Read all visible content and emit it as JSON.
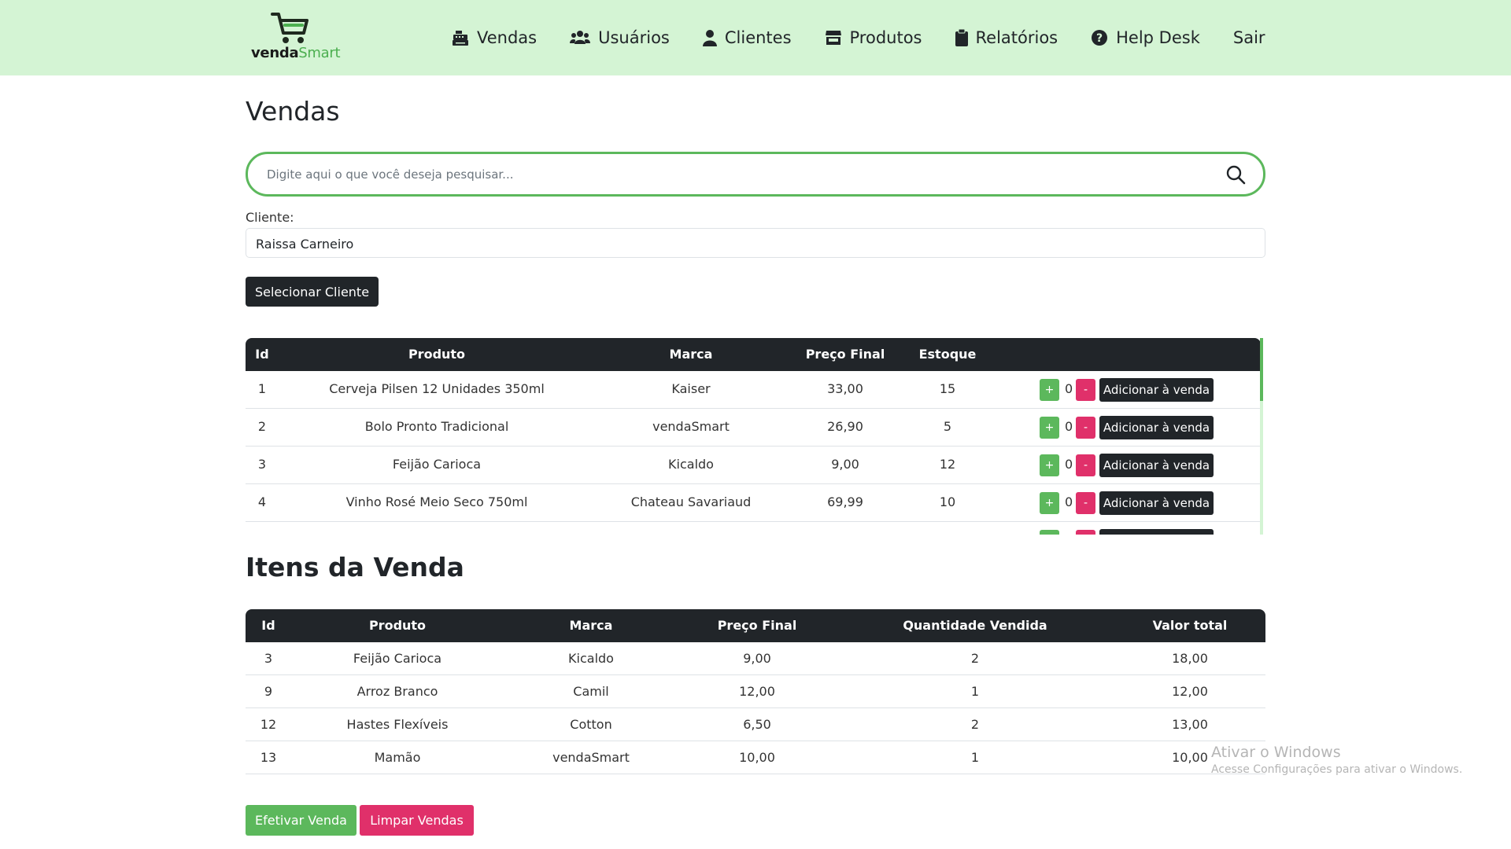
{
  "brand": {
    "part1": "venda",
    "part2": "Smart"
  },
  "nav": {
    "vendas": "Vendas",
    "usuarios": "Usuários",
    "clientes": "Clientes",
    "produtos": "Produtos",
    "relatorios": "Relatórios",
    "helpdesk": "Help Desk",
    "sair": "Sair"
  },
  "page": {
    "title": "Vendas"
  },
  "search": {
    "placeholder": "Digite aqui o que você deseja pesquisar...",
    "value": ""
  },
  "client": {
    "label": "Cliente:",
    "value": "Raissa Carneiro",
    "select_button": "Selecionar Cliente"
  },
  "products": {
    "headers": {
      "id": "Id",
      "produto": "Produto",
      "marca": "Marca",
      "preco": "Preço Final",
      "estoque": "Estoque"
    },
    "add_label": "Adicionar à venda",
    "rows": [
      {
        "id": "1",
        "produto": "Cerveja Pilsen 12 Unidades 350ml",
        "marca": "Kaiser",
        "preco": "33,00",
        "estoque": "15",
        "qty": "0"
      },
      {
        "id": "2",
        "produto": "Bolo Pronto Tradicional",
        "marca": "vendaSmart",
        "preco": "26,90",
        "estoque": "5",
        "qty": "0"
      },
      {
        "id": "3",
        "produto": "Feijão Carioca",
        "marca": "Kicaldo",
        "preco": "9,00",
        "estoque": "12",
        "qty": "0"
      },
      {
        "id": "4",
        "produto": "Vinho Rosé Meio Seco 750ml",
        "marca": "Chateau Savariaud",
        "preco": "69,99",
        "estoque": "10",
        "qty": "0"
      }
    ]
  },
  "sale_items": {
    "title": "Itens da Venda",
    "headers": {
      "id": "Id",
      "produto": "Produto",
      "marca": "Marca",
      "preco": "Preço Final",
      "quantidade": "Quantidade Vendida",
      "total": "Valor total"
    },
    "rows": [
      {
        "id": "3",
        "produto": "Feijão Carioca",
        "marca": "Kicaldo",
        "preco": "9,00",
        "quantidade": "2",
        "total": "18,00"
      },
      {
        "id": "9",
        "produto": "Arroz Branco",
        "marca": "Camil",
        "preco": "12,00",
        "quantidade": "1",
        "total": "12,00"
      },
      {
        "id": "12",
        "produto": "Hastes Flexíveis",
        "marca": "Cotton",
        "preco": "6,50",
        "quantidade": "2",
        "total": "13,00"
      },
      {
        "id": "13",
        "produto": "Mamão",
        "marca": "vendaSmart",
        "preco": "10,00",
        "quantidade": "1",
        "total": "10,00"
      }
    ]
  },
  "actions": {
    "confirm": "Efetivar Venda",
    "clear": "Limpar Vendas"
  },
  "watermark": {
    "line1": "Ativar o Windows",
    "line2": "Acesse Configurações para ativar o Windows."
  },
  "colors": {
    "navbar": "#d4f4d4",
    "accent_green": "#5cb85c",
    "accent_pink": "#e0306a",
    "dark": "#212529"
  }
}
